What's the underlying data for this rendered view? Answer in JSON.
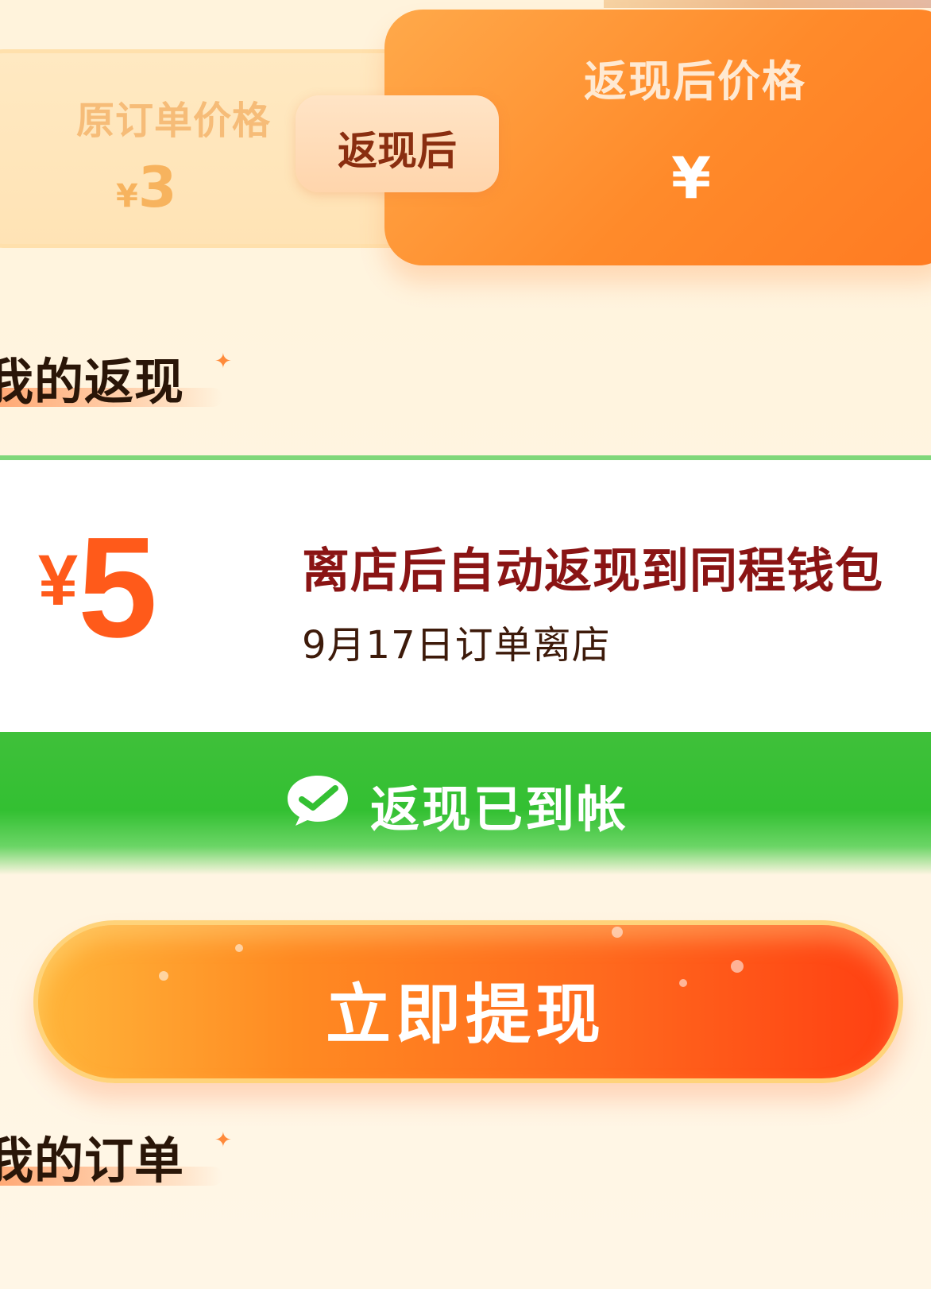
{
  "price_compare": {
    "original_label": "原订单价格",
    "original_symbol": "¥",
    "original_price": "3",
    "middle_tag": "返现后",
    "after_label": "返现后价格",
    "after_price": "¥"
  },
  "cashback_section": {
    "title": "我的返现",
    "amount_symbol": "¥",
    "amount": "5",
    "description": "离店后自动返现到同程钱包",
    "date_text": "9月17日订单离店",
    "status_text": "返现已到帐",
    "status_icon": "wechat-pay-icon"
  },
  "withdraw_button": {
    "label": "立即提现"
  },
  "order_section": {
    "title": "我的订单"
  },
  "colors": {
    "accent_orange": "#ff7a22",
    "success_green": "#33c032",
    "amount_red": "#ff5a1a",
    "desc_dark_red": "#8a1414"
  }
}
